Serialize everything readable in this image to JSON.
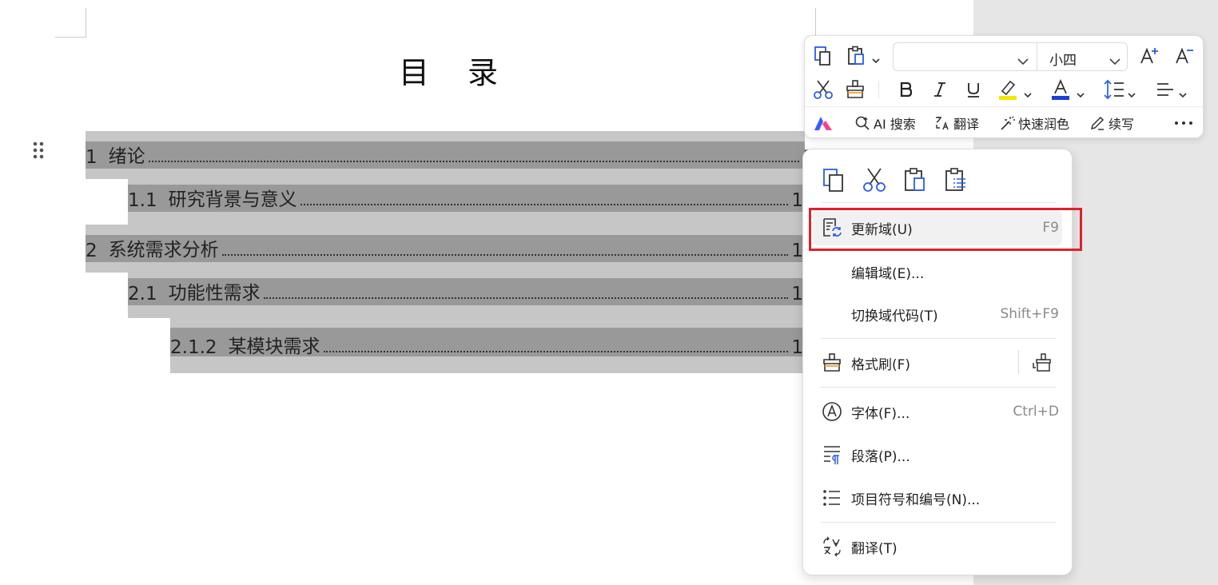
{
  "document": {
    "toc_title": "目 录",
    "toc_entries": [
      {
        "num": "1",
        "text": "绪论",
        "page": "1"
      },
      {
        "num": "1.1",
        "text": "研究背景与意义",
        "page": "1"
      },
      {
        "num": "2",
        "text": "系统需求分析",
        "page": "1"
      },
      {
        "num": "2.1",
        "text": "功能性需求",
        "page": "1"
      },
      {
        "num": "2.1.2",
        "text": "某模块需求",
        "page": "1"
      }
    ]
  },
  "mini_toolbar": {
    "font_name": "",
    "font_size": "小四",
    "ai_label": "AI 搜索",
    "translate_label": "翻译",
    "polish_label": "快速润色",
    "continue_label": "续写"
  },
  "context_menu": {
    "items": [
      {
        "label": "更新域(U)",
        "shortcut": "F9"
      },
      {
        "label": "编辑域(E)...",
        "shortcut": ""
      },
      {
        "label": "切换域代码(T)",
        "shortcut": "Shift+F9"
      },
      {
        "label": "格式刷(F)",
        "shortcut": ""
      },
      {
        "label": "字体(F)...",
        "shortcut": "Ctrl+D"
      },
      {
        "label": "段落(P)...",
        "shortcut": ""
      },
      {
        "label": "项目符号和编号(N)...",
        "shortcut": ""
      },
      {
        "label": "翻译(T)",
        "shortcut": ""
      }
    ]
  },
  "colors": {
    "accent": "#2b5ce6",
    "highlight_yellow": "#f5e600",
    "font_color_blue": "#1a3fd4",
    "selection_box": "#e0202a"
  }
}
